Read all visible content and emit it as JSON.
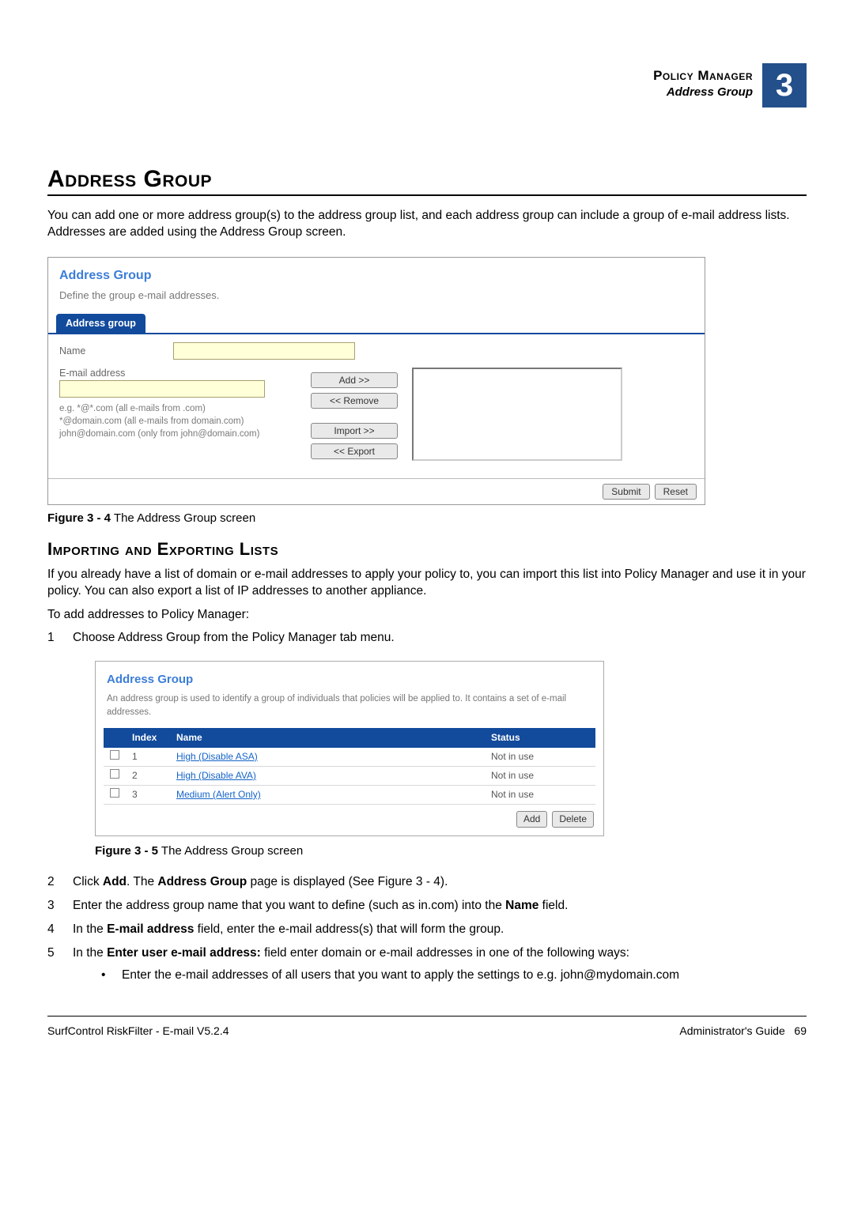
{
  "runhead": {
    "line1": "Policy Manager",
    "line2": "Address Group",
    "chapter": "3"
  },
  "main_heading": "Address Group",
  "intro": "You can add one or more address group(s) to the address group list, and each address group can include a group of e-mail address lists. Addresses are added using the Address Group screen.",
  "fig1": {
    "panel_title": "Address Group",
    "panel_desc": "Define the group e-mail addresses.",
    "tab_label": "Address group",
    "name_label": "Name",
    "email_label": "E-mail address",
    "hint1": "e.g. *@*.com (all e-mails from .com)",
    "hint2": "*@domain.com (all e-mails from domain.com)",
    "hint3": "john@domain.com (only from john@domain.com)",
    "btn_add": "Add >>",
    "btn_remove": "<< Remove",
    "btn_import": "Import >>",
    "btn_export": "<< Export",
    "btn_submit": "Submit",
    "btn_reset": "Reset",
    "caption_prefix": "Figure 3 - 4",
    "caption_text": " The Address Group screen"
  },
  "sub_heading": "Importing and Exporting Lists",
  "para2": "If you already have a list of domain or e-mail addresses to apply your policy to, you can import this list into Policy Manager and use it in your policy. You can also export a list of IP addresses to another appliance.",
  "para3": "To add addresses to Policy Manager:",
  "step1": "Choose Address Group from the Policy Manager tab menu.",
  "fig2": {
    "panel_title": "Address Group",
    "panel_desc": "An address group is used to identify a group of individuals that policies will be applied to. It contains a set of e-mail addresses.",
    "col_index": "Index",
    "col_name": "Name",
    "col_status": "Status",
    "rows": [
      {
        "idx": "1",
        "name": "High (Disable ASA)",
        "status": "Not in use"
      },
      {
        "idx": "2",
        "name": "High (Disable AVA)",
        "status": "Not in use"
      },
      {
        "idx": "3",
        "name": "Medium (Alert Only)",
        "status": "Not in use"
      }
    ],
    "btn_add": "Add",
    "btn_delete": "Delete",
    "caption_prefix": "Figure 3 - 5",
    "caption_text": " The Address Group screen"
  },
  "step2_pre": "Click ",
  "step2_bold1": "Add",
  "step2_mid": ". The ",
  "step2_bold2": "Address Group",
  "step2_post": " page is displayed (See Figure 3 - 4).",
  "step3_pre": "Enter the address group name that you want to define (such as in.com) into the ",
  "step3_bold": "Name",
  "step3_post": " field.",
  "step4_pre": "In the ",
  "step4_bold": "E-mail address",
  "step4_post": " field, enter the e-mail address(s) that will form the group.",
  "step5_pre": "In the ",
  "step5_bold": "Enter user e-mail address:",
  "step5_post": " field enter domain or e-mail addresses in one of the following ways:",
  "step5_bullet1": "Enter the e-mail addresses of all users that you want to apply the settings to e.g. john@mydomain.com",
  "footer": {
    "left": "SurfControl RiskFilter - E-mail V5.2.4",
    "right_label": "Administrator's Guide",
    "page": "69"
  }
}
